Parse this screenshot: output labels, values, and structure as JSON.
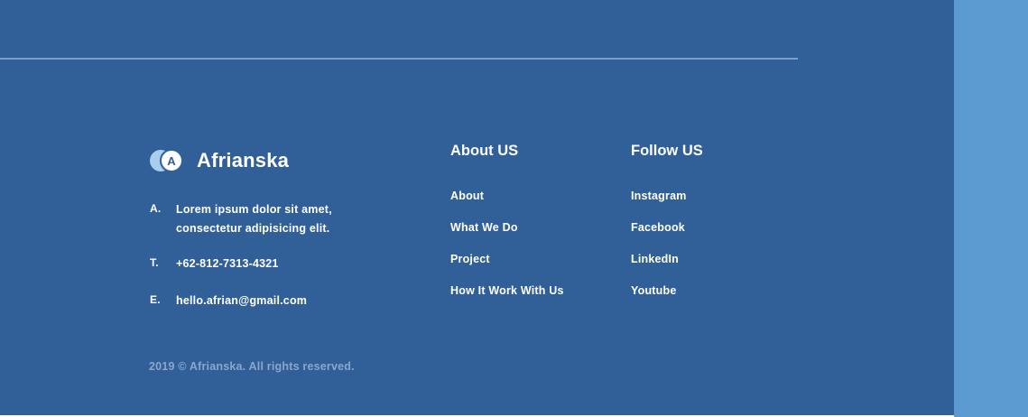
{
  "brand": {
    "logo_letter": "A",
    "name": "Afrianska"
  },
  "contact": {
    "address_key": "A.",
    "address_line1": "Lorem ipsum dolor sit amet,",
    "address_line2": "consectetur adipisicing elit.",
    "phone_key": "T.",
    "phone": "+62-812-7313-4321",
    "email_key": "E.",
    "email": "hello.afrian@gmail.com"
  },
  "about": {
    "title": "About US",
    "links": [
      "About",
      "What We Do",
      "Project",
      "How It Work With Us"
    ]
  },
  "follow": {
    "title": "Follow US",
    "links": [
      "Instagram",
      "Facebook",
      "LinkedIn",
      "Youtube"
    ]
  },
  "copyright": "2019 © Afrianska. All rights reserved.",
  "colors": {
    "footer_bg": "#316099",
    "side_strip": "#5b9ad1",
    "divider": "#7d9fca",
    "muted_text": "#8aa6cb",
    "logo_accent": "#a8cdee"
  }
}
